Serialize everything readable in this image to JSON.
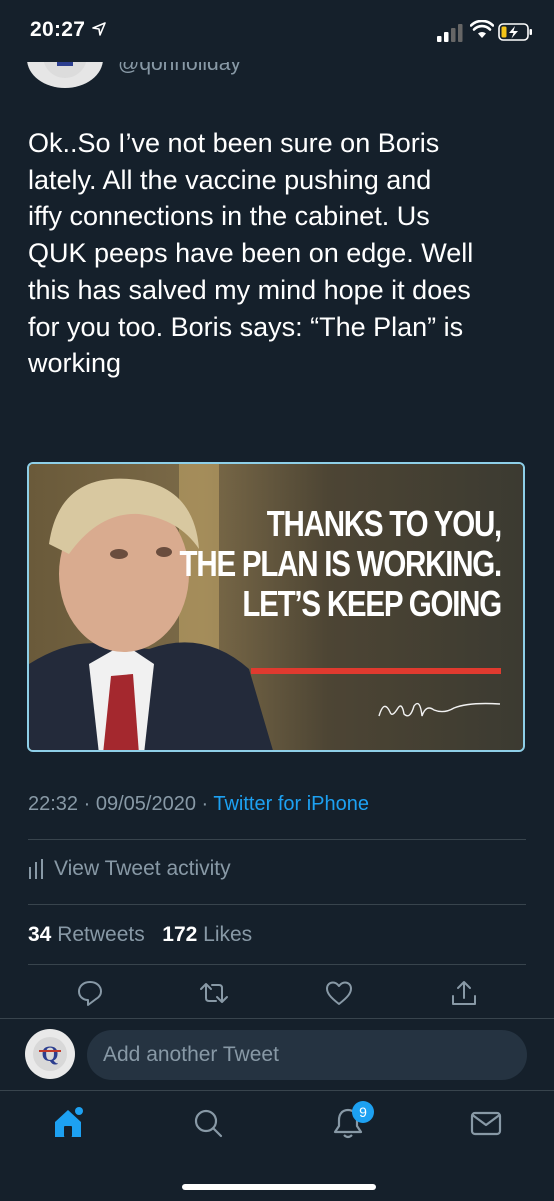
{
  "status_bar": {
    "time": "20:27"
  },
  "tweet": {
    "handle": "@qonholiday",
    "text": "Ok..So I’ve not been sure on Boris\nlately.  All the vaccine pushing and\niffy connections in the cabinet.  Us\nQUK peeps have been on edge.  Well\nthis has salved my mind hope it does\nfor you too.  Boris says: “The Plan” is\nworking",
    "media": {
      "line1": "THANKS TO YOU,",
      "line2": "THE PLAN IS WORKING.",
      "line3": "LET’S KEEP GOING",
      "accent_color": "#e03a2f"
    },
    "meta": {
      "time": "22:32",
      "sep1": " · ",
      "date": "09/05/2020",
      "sep2": " · ",
      "source": "Twitter for iPhone"
    },
    "activity_label": "View Tweet activity",
    "stats": {
      "retweets_count": "34",
      "retweets_label": "Retweets",
      "likes_count": "172",
      "likes_label": "Likes"
    }
  },
  "actions": [
    "reply-icon",
    "retweet-icon",
    "like-icon",
    "share-icon"
  ],
  "compose": {
    "placeholder": "Add another Tweet"
  },
  "tabbar": {
    "notifications_badge": "9"
  },
  "colors": {
    "background": "#15202b",
    "accent": "#1da1f2",
    "muted": "#8899a6",
    "divider": "#38444d"
  }
}
